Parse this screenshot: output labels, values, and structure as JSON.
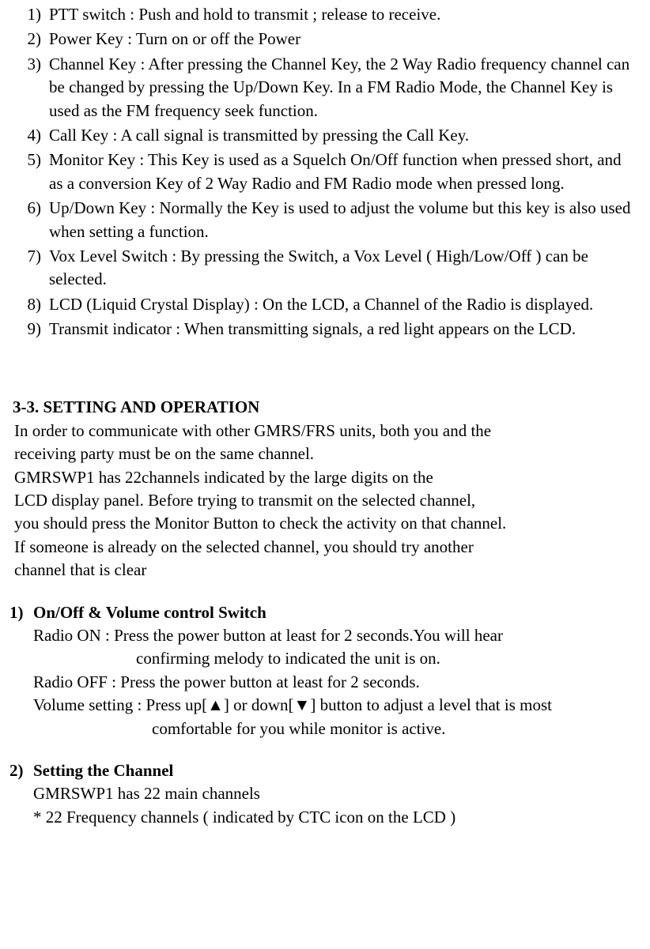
{
  "list": [
    {
      "num": "1)",
      "text": "PTT switch : Push and hold to transmit ; release to receive."
    },
    {
      "num": "2)",
      "text": "Power Key : Turn on or off the Power"
    },
    {
      "num": "3)",
      "text": "Channel Key : After pressing the Channel Key, the 2 Way Radio frequency channel can be changed by pressing the Up/Down Key. In a FM Radio Mode, the Channel Key is used as the FM frequency seek function."
    },
    {
      "num": "4)",
      "text": "Call Key : A call signal is transmitted by pressing the Call Key."
    },
    {
      "num": "5)",
      "text": "Monitor Key : This Key is used as a Squelch On/Off function when pressed short, and as a conversion Key of 2 Way Radio and FM Radio mode when pressed long."
    },
    {
      "num": "6)",
      "text": "Up/Down Key : Normally the Key is used to adjust the volume but this key is also used when setting a function."
    },
    {
      "num": "7)",
      "text": "Vox Level Switch : By pressing the Switch, a Vox Level ( High/Low/Off ) can be selected."
    },
    {
      "num": "8)",
      "text": "LCD (Liquid Crystal Display) : On the LCD, a Channel of the Radio is displayed."
    },
    {
      "num": "9)",
      "text": "Transmit indicator : When transmitting signals, a red light appears on the LCD."
    }
  ],
  "section_heading": "3-3. SETTING AND OPERATION",
  "intro": [
    "In order to communicate with other GMRS/FRS units, both you and the",
    "receiving party must be on the same channel.",
    "GMRSWP1 has 22channels indicated by the large digits on the",
    "LCD display panel.    Before trying to transmit on the selected channel,",
    "you should press the Monitor Button to check the activity on that channel.",
    "If someone is already on the selected channel, you should try another",
    "channel that is clear"
  ],
  "sub1": {
    "num": "1)",
    "title": "On/Off & Volume control Switch",
    "line1": "Radio ON : Press the power button at least for 2 seconds.You will hear",
    "line1b": "confirming melody to indicated the unit is on.",
    "line2": "Radio OFF : Press the power button at least for 2 seconds.",
    "line3": "Volume setting : Press up[▲] or down[▼] button to adjust a level that is most",
    "line3b": "comfortable for you while monitor is active."
  },
  "sub2": {
    "num": "2)",
    "title": "Setting the Channel",
    "line1": "GMRSWP1 has 22 main channels",
    "line2": "* 22 Frequency channels ( indicated by CTC icon on the LCD )"
  }
}
